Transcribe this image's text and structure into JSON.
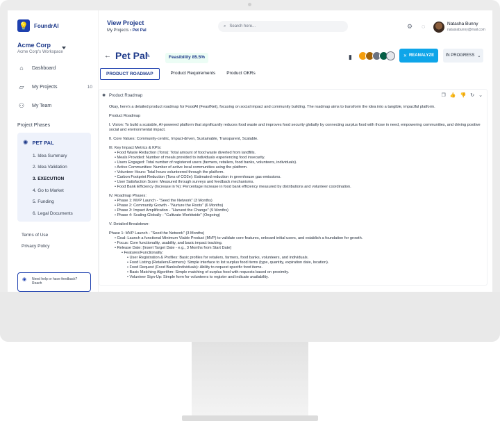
{
  "app": {
    "name": "FoundrAI"
  },
  "workspace": {
    "name": "Acme Corp",
    "sub": "Acme Corp's Workspace"
  },
  "nav": [
    {
      "label": "Dashboard",
      "icon": "home-icon",
      "count": ""
    },
    {
      "label": "My Projects",
      "icon": "projects-icon",
      "count": "10"
    },
    {
      "label": "My Team",
      "icon": "team-icon",
      "count": ""
    }
  ],
  "phases": {
    "label": "Project Phases",
    "project": "PET PAL",
    "items": [
      "1. Idea Summary",
      "2. Idea Validation",
      "3. EXECUTION",
      "4. Go to Market",
      "5. Funding",
      "6. Legal Documents"
    ],
    "active_index": 2
  },
  "footer_links": [
    "Terms of Use",
    "Privacy Policy"
  ],
  "help_text": "Need help or have feedback? Reach",
  "topbar": {
    "view_project": "View Project",
    "crumb_root": "My Projects",
    "crumb_sep": "›",
    "crumb_current": "Pet Pal",
    "search_placeholder": "Search here...",
    "user_name": "Natasha Bunny",
    "user_email": "natasiabunny@mail.com"
  },
  "header": {
    "title": "Pet Pal",
    "feasibility": "Feasibility 85.5%",
    "reanalyze": "REANALYZE",
    "status": "IN PROGRESS",
    "avatar_colors": [
      "#f59e0b",
      "#a16207",
      "#6b7280",
      "#065f46",
      "#d1d5db"
    ]
  },
  "tabs": [
    "PRODUCT ROADMAP",
    "Product Requirements",
    "Product OKRs"
  ],
  "panel": {
    "title": "Product Roadmap"
  },
  "content": [
    {
      "t": "Okay, here's a detailed product roadmap for FoodAI (FeastNet), focusing on social impact and community building. The roadmap aims to transform the idea into a tangible, impactful platform.",
      "i": 0
    },
    {
      "t": "",
      "i": -1
    },
    {
      "t": "Product Roadmap",
      "i": 0
    },
    {
      "t": "",
      "i": -1
    },
    {
      "t": "I. Vision: To build a scalable, AI-powered platform that significantly reduces food waste and improves food security globally by connecting surplus food with those in need, empowering communities, and driving positive social and environmental impact.",
      "i": 0
    },
    {
      "t": "",
      "i": -1
    },
    {
      "t": "II. Core Values: Community-centric, Impact-driven, Sustainable, Transparent, Scalable.",
      "i": 0
    },
    {
      "t": "",
      "i": -1
    },
    {
      "t": "III. Key Impact Metrics & KPIs:",
      "i": 0
    },
    {
      "t": "• Food Waste Reduction (Tons): Total amount of food waste diverted from landfills.",
      "i": 1
    },
    {
      "t": "• Meals Provided: Number of meals provided to individuals experiencing food insecurity.",
      "i": 1
    },
    {
      "t": "• Users Engaged: Total number of registered users (farmers, retailers, food banks, volunteers, individuals).",
      "i": 1
    },
    {
      "t": "• Active Communities: Number of active local communities using the platform.",
      "i": 1
    },
    {
      "t": "• Volunteer Hours: Total hours volunteered through the platform.",
      "i": 1
    },
    {
      "t": "• Carbon Footprint Reduction (Tons of CO2e): Estimated reduction in greenhouse gas emissions.",
      "i": 1
    },
    {
      "t": "• User Satisfaction Score: Measured through surveys and feedback mechanisms.",
      "i": 1
    },
    {
      "t": "• Food Bank Efficiency (Increase in %): Percentage increase in food bank efficiency measured by distributions and volunteer coordination.",
      "i": 1
    },
    {
      "t": "",
      "i": -1
    },
    {
      "t": "IV. Roadmap Phases:",
      "i": 0
    },
    {
      "t": "• Phase 1: MVP Launch - \"Seed the Network\" (3 Months)",
      "i": 1
    },
    {
      "t": "• Phase 2: Community Growth - \"Nurture the Roots\" (6 Months)",
      "i": 1
    },
    {
      "t": "• Phase 3: Impact Amplification - \"Harvest the Change\" (9 Months)",
      "i": 1
    },
    {
      "t": "• Phase 4: Scaling Globally - \"Cultivate Worldwide\" (Ongoing)",
      "i": 1
    },
    {
      "t": "",
      "i": -1
    },
    {
      "t": "V. Detailed Breakdown:",
      "i": 0
    },
    {
      "t": "",
      "i": -1
    },
    {
      "t": "Phase 1: MVP Launch - \"Seed the Network\" (3 Months)",
      "i": 0
    },
    {
      "t": "• Goal: Launch a functional Minimum Viable Product (MVP) to validate core features, onboard initial users, and establish a foundation for growth.",
      "i": 1
    },
    {
      "t": "• Focus: Core functionality, usability, and basic impact tracking.",
      "i": 1
    },
    {
      "t": "• Release Date: [Insert Target Date - e.g., 3 Months from Start Date]",
      "i": 1
    },
    {
      "t": "• Features/Functionality:",
      "i": 2
    },
    {
      "t": "• User Registration & Profiles: Basic profiles for retailers, farmers, food banks, volunteers, and individuals.",
      "i": 3
    },
    {
      "t": "• Food Listing (Retailers/Farmers): Simple interface to list surplus food items (type, quantity, expiration date, location).",
      "i": 3
    },
    {
      "t": "• Food Request (Food Banks/Individuals): Ability to request specific food items.",
      "i": 3
    },
    {
      "t": "• Basic Matching Algorithm: Simple matching of surplus food with requests based on proximity.",
      "i": 3
    },
    {
      "t": "• Volunteer Sign-Up: Simple form for volunteers to register and indicate availability.",
      "i": 3
    }
  ]
}
